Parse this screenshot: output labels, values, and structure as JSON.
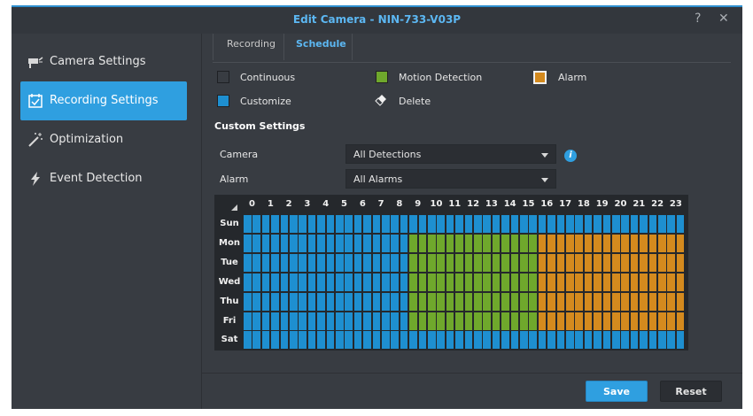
{
  "window": {
    "title": "Edit Camera - NIN-733-V03P",
    "help_glyph": "?",
    "close_glyph": "✕"
  },
  "sidebar": {
    "items": [
      {
        "label": "Camera Settings",
        "icon": "camera-icon",
        "active": false
      },
      {
        "label": "Recording Settings",
        "icon": "calendar-check-icon",
        "active": true
      },
      {
        "label": "Optimization",
        "icon": "magic-wand-icon",
        "active": false
      },
      {
        "label": "Event Detection",
        "icon": "lightning-icon",
        "active": false
      }
    ]
  },
  "tabs": [
    {
      "label": "Recording",
      "active": false
    },
    {
      "label": "Schedule",
      "active": true
    }
  ],
  "legend": {
    "continuous": "Continuous",
    "motion": "Motion Detection",
    "alarm": "Alarm",
    "customize": "Customize",
    "delete": "Delete"
  },
  "colors": {
    "continuous": "#383c42",
    "motion": "#6fa82c",
    "alarm": "#d48a1e",
    "customize": "#1e8fd0",
    "accent": "#2f9fe0"
  },
  "custom_settings": {
    "title": "Custom Settings",
    "camera_label": "Camera",
    "camera_value": "All Detections",
    "alarm_label": "Alarm",
    "alarm_value": "All Alarms"
  },
  "schedule": {
    "hours": [
      "0",
      "1",
      "2",
      "3",
      "4",
      "5",
      "6",
      "7",
      "8",
      "9",
      "10",
      "11",
      "12",
      "13",
      "14",
      "15",
      "16",
      "17",
      "18",
      "19",
      "20",
      "21",
      "22",
      "23"
    ],
    "days": [
      "Sun",
      "Mon",
      "Tue",
      "Wed",
      "Thu",
      "Fri",
      "Sat"
    ],
    "slots": {
      "Sun": {
        "customize": [
          0,
          24
        ]
      },
      "Mon": {
        "customize": [
          0,
          9
        ],
        "motion": [
          9,
          16
        ],
        "alarm": [
          16,
          24
        ]
      },
      "Tue": {
        "customize": [
          0,
          9
        ],
        "motion": [
          9,
          16
        ],
        "alarm": [
          16,
          24
        ]
      },
      "Wed": {
        "customize": [
          0,
          9
        ],
        "motion": [
          9,
          16
        ],
        "alarm": [
          16,
          24
        ]
      },
      "Thu": {
        "customize": [
          0,
          9
        ],
        "motion": [
          9,
          16
        ],
        "alarm": [
          16,
          24
        ]
      },
      "Fri": {
        "customize": [
          0,
          9
        ],
        "motion": [
          9,
          16
        ],
        "alarm": [
          16,
          24
        ]
      },
      "Sat": {
        "customize": [
          0,
          24
        ]
      }
    }
  },
  "footer": {
    "save": "Save",
    "reset": "Reset"
  }
}
